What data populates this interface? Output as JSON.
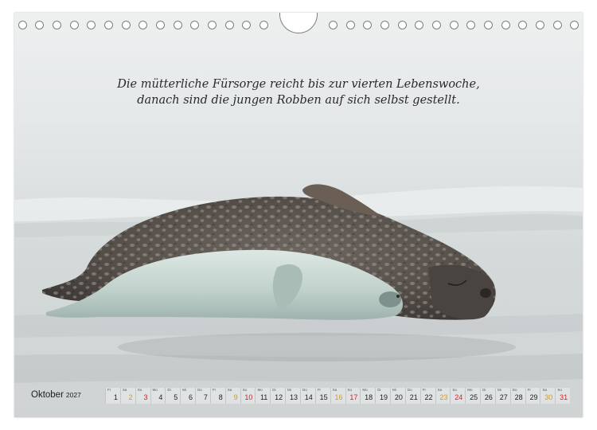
{
  "quote": {
    "line1": "Die mütterliche Fürsorge reicht bis zur vierten Lebenswoche,",
    "line2": "danach sind die jungen Robben auf sich selbst gestellt."
  },
  "calendar": {
    "month": "Oktober",
    "year": "2027",
    "days": [
      {
        "num": "1",
        "wd": "Fr",
        "kind": "weekday"
      },
      {
        "num": "2",
        "wd": "Sa",
        "kind": "sat"
      },
      {
        "num": "3",
        "wd": "So",
        "kind": "sun"
      },
      {
        "num": "4",
        "wd": "Mo",
        "kind": "weekday"
      },
      {
        "num": "5",
        "wd": "Di",
        "kind": "weekday"
      },
      {
        "num": "6",
        "wd": "Mi",
        "kind": "weekday"
      },
      {
        "num": "7",
        "wd": "Do",
        "kind": "weekday"
      },
      {
        "num": "8",
        "wd": "Fr",
        "kind": "weekday"
      },
      {
        "num": "9",
        "wd": "Sa",
        "kind": "sat"
      },
      {
        "num": "10",
        "wd": "So",
        "kind": "sun"
      },
      {
        "num": "11",
        "wd": "Mo",
        "kind": "weekday"
      },
      {
        "num": "12",
        "wd": "Di",
        "kind": "weekday"
      },
      {
        "num": "13",
        "wd": "Mi",
        "kind": "weekday"
      },
      {
        "num": "14",
        "wd": "Do",
        "kind": "weekday"
      },
      {
        "num": "15",
        "wd": "Fr",
        "kind": "weekday"
      },
      {
        "num": "16",
        "wd": "Sa",
        "kind": "sat"
      },
      {
        "num": "17",
        "wd": "So",
        "kind": "sun"
      },
      {
        "num": "18",
        "wd": "Mo",
        "kind": "weekday"
      },
      {
        "num": "19",
        "wd": "Di",
        "kind": "weekday"
      },
      {
        "num": "20",
        "wd": "Mi",
        "kind": "weekday"
      },
      {
        "num": "21",
        "wd": "Do",
        "kind": "weekday"
      },
      {
        "num": "22",
        "wd": "Fr",
        "kind": "weekday"
      },
      {
        "num": "23",
        "wd": "Sa",
        "kind": "sat"
      },
      {
        "num": "24",
        "wd": "So",
        "kind": "sun"
      },
      {
        "num": "25",
        "wd": "Mo",
        "kind": "weekday"
      },
      {
        "num": "26",
        "wd": "Di",
        "kind": "weekday"
      },
      {
        "num": "27",
        "wd": "Mi",
        "kind": "weekday"
      },
      {
        "num": "28",
        "wd": "Do",
        "kind": "weekday"
      },
      {
        "num": "29",
        "wd": "Fr",
        "kind": "weekday"
      },
      {
        "num": "30",
        "wd": "Sa",
        "kind": "sat"
      },
      {
        "num": "31",
        "wd": "So",
        "kind": "sun"
      }
    ]
  },
  "photo": {
    "subject": "grey-seal-mother-and-pup-icon"
  }
}
